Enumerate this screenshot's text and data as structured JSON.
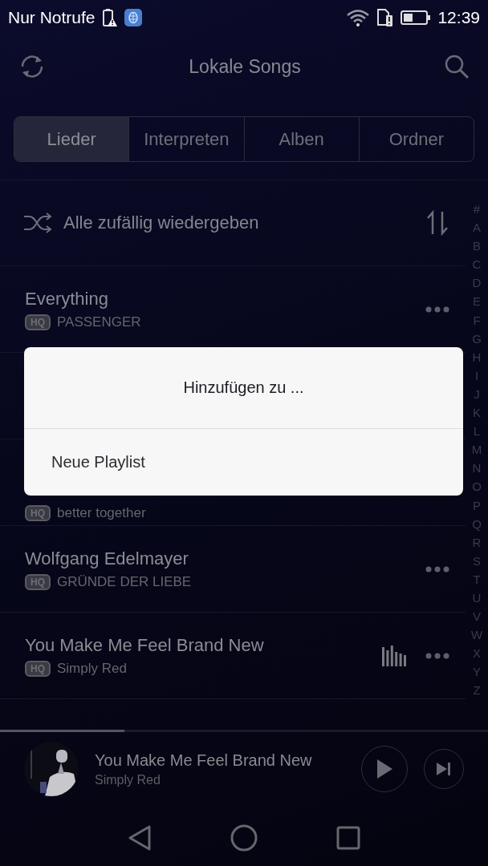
{
  "status_bar": {
    "carrier": "Nur Notrufe",
    "time": "12:39"
  },
  "header": {
    "title": "Lokale Songs"
  },
  "tabs": [
    {
      "label": "Lieder",
      "selected": true
    },
    {
      "label": "Interpreten",
      "selected": false
    },
    {
      "label": "Alben",
      "selected": false
    },
    {
      "label": "Ordner",
      "selected": false
    }
  ],
  "shuffle": {
    "label": "Alle zufällig wiedergeben"
  },
  "songs": [
    {
      "kind": "song",
      "title": "Everything",
      "badge": "HQ",
      "subtitle": "PASSENGER",
      "playing": false
    },
    {
      "kind": "covered"
    },
    {
      "kind": "partly_covered",
      "badge": "HQ",
      "subtitle": "better together"
    },
    {
      "kind": "song",
      "title": "Wolfgang Edelmayer",
      "badge": "HQ",
      "subtitle": "GRÜNDE DER LIEBE",
      "playing": false
    },
    {
      "kind": "song",
      "title": "You Make Me Feel Brand New",
      "badge": "HQ",
      "subtitle": "Simply Red",
      "playing": true
    }
  ],
  "index_letters": [
    "#",
    "A",
    "B",
    "C",
    "D",
    "E",
    "F",
    "G",
    "H",
    "I",
    "J",
    "K",
    "L",
    "M",
    "N",
    "O",
    "P",
    "Q",
    "R",
    "S",
    "T",
    "U",
    "V",
    "W",
    "X",
    "Y",
    "Z"
  ],
  "player": {
    "level": 0.255,
    "title": "You Make Me Feel Brand New",
    "artist": "Simply Red"
  },
  "dialog": {
    "title": "Hinzufügen zu ...",
    "items": [
      "Neue Playlist"
    ]
  }
}
